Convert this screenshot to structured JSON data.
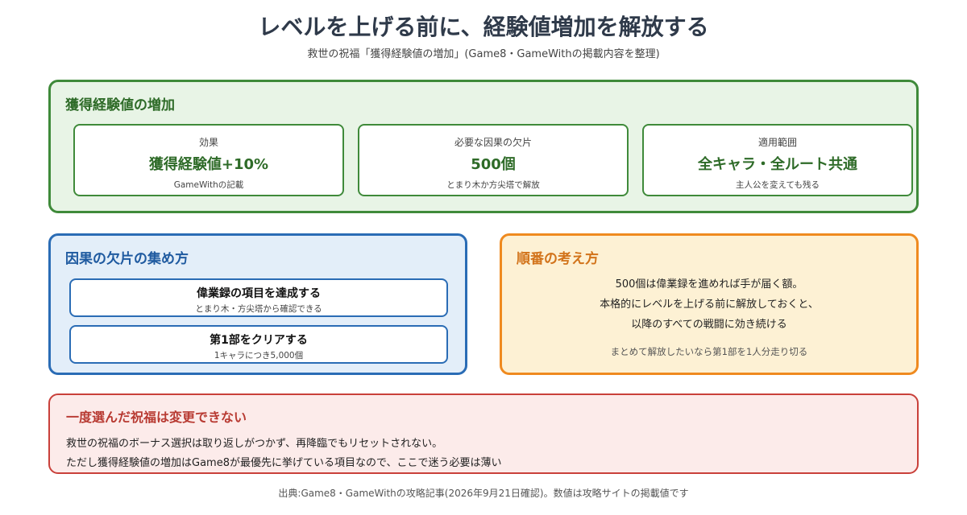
{
  "header": {
    "title": "レベルを上げる前に、経験値増加を解放する",
    "subtitle": "救世の祝福「獲得経験値の増加」(Game8・GameWithの掲載内容を整理)"
  },
  "effect_panel": {
    "heading": "獲得経験値の増加",
    "cards": [
      {
        "label": "効果",
        "value": "獲得経験値+10%",
        "note": "GameWithの記載"
      },
      {
        "label": "必要な因果の欠片",
        "value": "500個",
        "note": "とまり木か方尖塔で解放"
      },
      {
        "label": "適用範囲",
        "value": "全キャラ・全ルート共通",
        "note": "主人公を変えても残る"
      }
    ]
  },
  "collect_panel": {
    "heading": "因果の欠片の集め方",
    "methods": [
      {
        "title": "偉業録の項目を達成する",
        "note": "とまり木・方尖塔から確認できる"
      },
      {
        "title": "第1部をクリアする",
        "note": "1キャラにつき5,000個"
      }
    ]
  },
  "order_panel": {
    "heading": "順番の考え方",
    "lines": [
      "500個は偉業録を進めれば手が届く額。",
      "本格的にレベルを上げる前に解放しておくと、",
      "以降のすべての戦闘に効き続ける"
    ],
    "note": "まとめて解放したいなら第1部を1人分走り切る"
  },
  "warning_panel": {
    "heading": "一度選んだ祝福は変更できない",
    "lines": [
      "救世の祝福のボーナス選択は取り返しがつかず、再降臨でもリセットされない。",
      "ただし獲得経験値の増加はGame8が最優先に挙げている項目なので、ここで迷う必要は薄い"
    ]
  },
  "footer": {
    "source": "出典:Game8・GameWithの攻略記事(2026年9月21日確認)。数値は攻略サイトの掲載値です"
  },
  "colors": {
    "green": "#3f8a3a",
    "blue": "#2a6cb5",
    "orange": "#ef8a1f",
    "red": "#c9403a"
  }
}
